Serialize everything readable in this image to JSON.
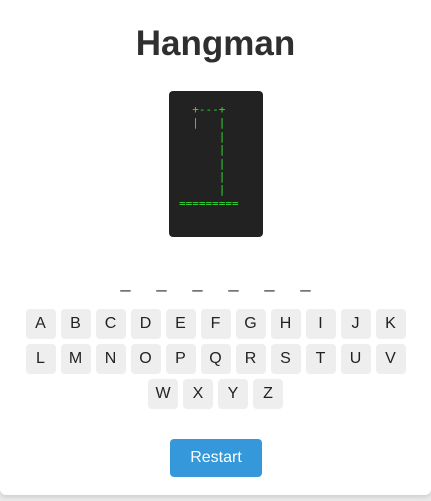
{
  "title": "Hangman",
  "gallows_art": "  +---+\n  |   |\n      |\n      |\n      |\n      |\n      |\n=========",
  "word_slots": [
    "_",
    "_",
    "_",
    "_",
    "_",
    "_"
  ],
  "keyboard_rows": [
    [
      "A",
      "B",
      "C",
      "D",
      "E",
      "F",
      "G",
      "H",
      "I",
      "J",
      "K"
    ],
    [
      "L",
      "M",
      "N",
      "O",
      "P",
      "Q",
      "R",
      "S",
      "T",
      "U",
      "V"
    ],
    [
      "W",
      "X",
      "Y",
      "Z"
    ]
  ],
  "restart_label": "Restart",
  "colors": {
    "accent": "#3498db",
    "gallows_bg": "#222222",
    "gallows_fg": "#33dd33",
    "key_bg": "#eeeeee"
  }
}
